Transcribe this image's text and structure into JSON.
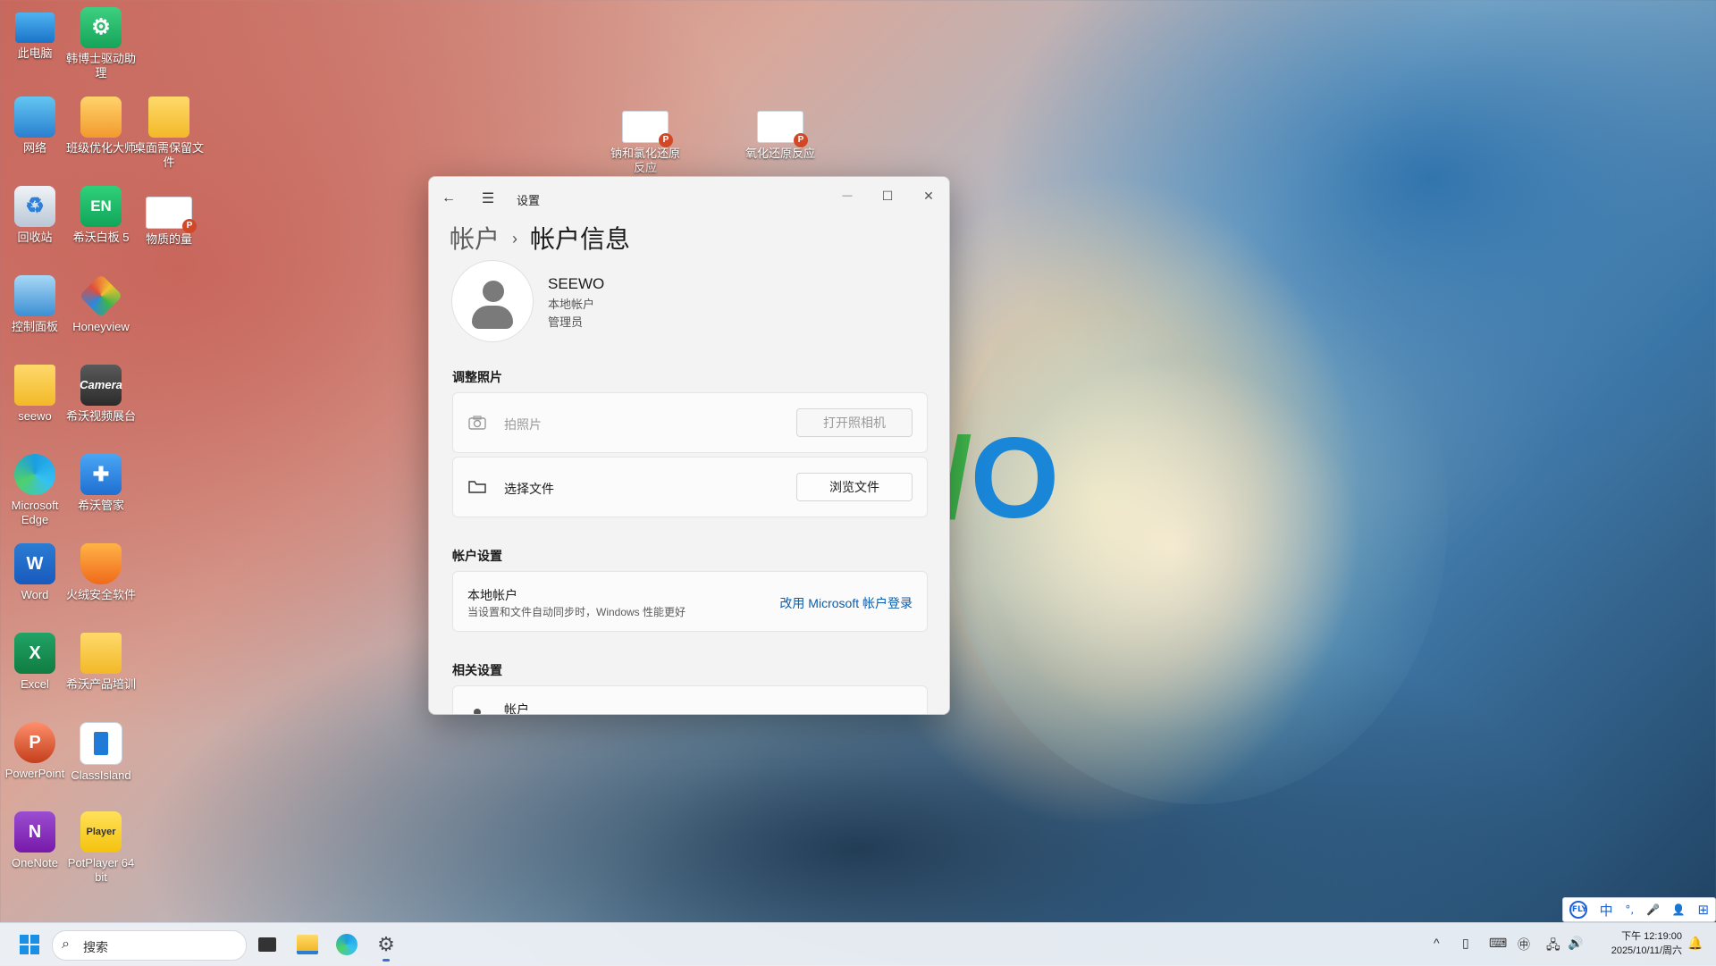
{
  "desktop": {
    "icons": [
      {
        "label": "此电脑"
      },
      {
        "label": "韩博士驱动助理"
      },
      {
        "label": "网络"
      },
      {
        "label": "班级优化大师"
      },
      {
        "label": "桌面需保留文件"
      },
      {
        "label": "回收站"
      },
      {
        "label": "希沃白板 5"
      },
      {
        "label": "物质的量"
      },
      {
        "label": "控制面板"
      },
      {
        "label": "Honeyview"
      },
      {
        "label": "seewo"
      },
      {
        "label": "希沃视频展台"
      },
      {
        "label": "Microsoft Edge"
      },
      {
        "label": "希沃管家"
      },
      {
        "label": "Word"
      },
      {
        "label": "火绒安全软件"
      },
      {
        "label": "Excel"
      },
      {
        "label": "希沃产品培训"
      },
      {
        "label": "PowerPoint"
      },
      {
        "label": "ClassIsland"
      },
      {
        "label": "OneNote"
      },
      {
        "label": "PotPlayer 64 bit"
      },
      {
        "label": "钠和氯化还原反应"
      },
      {
        "label": "氧化还原反应"
      }
    ],
    "wallpaper_brand": {
      "prefix": "/",
      "text": "O"
    },
    "icon_glyphs": {
      "en": "EN",
      "word": "W",
      "excel": "X",
      "ppt": "P",
      "onenote": "N",
      "camera": "Camera",
      "player": "Player"
    }
  },
  "window": {
    "title": "设置",
    "back_glyph": "←",
    "menu_glyph": "☰",
    "minimize_glyph": "—",
    "maximize_glyph": "☐",
    "close_glyph": "✕",
    "breadcrumb": {
      "parent": "帐户",
      "separator": "›",
      "current": "帐户信息"
    },
    "user": {
      "name": "SEEWO",
      "type": "本地帐户",
      "role": "管理员"
    },
    "photo_section": {
      "title": "调整照片",
      "take_photo": {
        "label": "拍照片",
        "button": "打开照相机",
        "icon": "camera-icon"
      },
      "choose_file": {
        "label": "选择文件",
        "button": "浏览文件",
        "icon": "folder-icon"
      }
    },
    "account_section": {
      "title": "帐户设置",
      "local_title": "本地帐户",
      "local_desc": "当设置和文件自动同步时，Windows 性能更好",
      "switch_link": "改用 Microsoft 帐户登录"
    },
    "related_section": {
      "title": "相关设置",
      "first_item": "帐户"
    }
  },
  "taskbar": {
    "search_placeholder": "搜索",
    "clock_time": "下午 12:19:00",
    "clock_date": "2025/10/11/周六",
    "ime": [
      "中",
      "°,",
      "🎤",
      "👤",
      "⊞"
    ],
    "ime_logo": "iFLY",
    "tray_glyphs": {
      "chevron": "^",
      "usb": "▯",
      "keyboard": "⌨",
      "ime": "㊥",
      "network": "🖧",
      "volume": "🔊",
      "bell": "🔔"
    }
  },
  "colors": {
    "accent": "#0b5cad",
    "window_bg": "#f3f3f3",
    "taskbar_bg": "#ecf0f6"
  }
}
